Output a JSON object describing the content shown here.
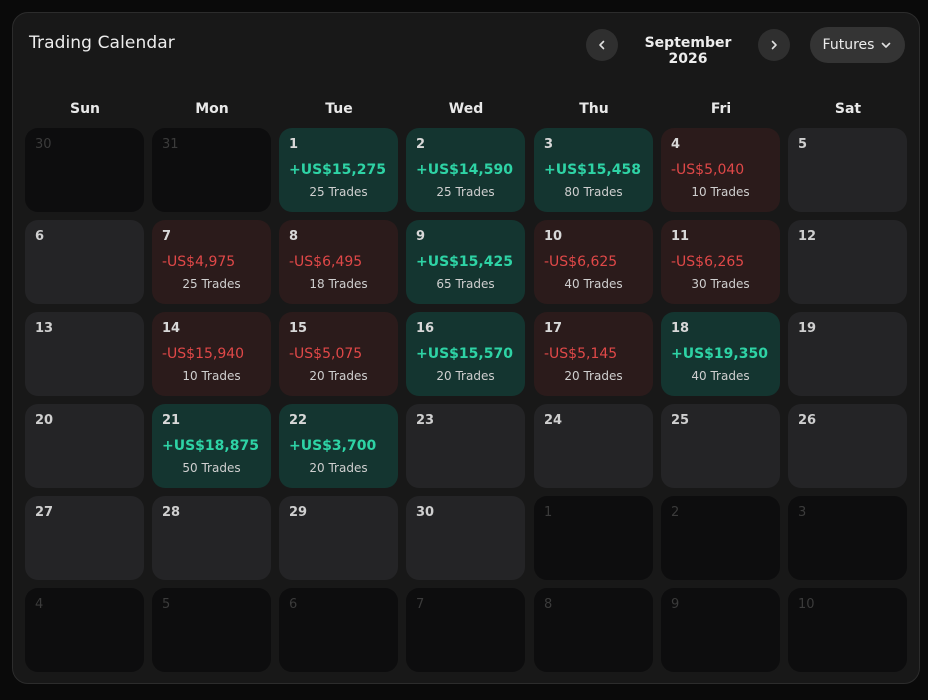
{
  "header": {
    "title": "Trading Calendar",
    "month_label": "September 2026",
    "dropdown_label": "Futures"
  },
  "weekdays": [
    "Sun",
    "Mon",
    "Tue",
    "Wed",
    "Thu",
    "Fri",
    "Sat"
  ],
  "weeks": [
    [
      {
        "day": "30",
        "state": "muted"
      },
      {
        "day": "31",
        "state": "muted"
      },
      {
        "day": "1",
        "state": "pos",
        "pnl": "+US$15,275",
        "trades": "25 Trades"
      },
      {
        "day": "2",
        "state": "pos",
        "pnl": "+US$14,590",
        "trades": "25 Trades"
      },
      {
        "day": "3",
        "state": "pos",
        "pnl": "+US$15,458",
        "trades": "80 Trades"
      },
      {
        "day": "4",
        "state": "neg",
        "pnl": "-US$5,040",
        "trades": "10 Trades"
      },
      {
        "day": "5",
        "state": "empty"
      }
    ],
    [
      {
        "day": "6",
        "state": "empty"
      },
      {
        "day": "7",
        "state": "neg",
        "pnl": "-US$4,975",
        "trades": "25 Trades"
      },
      {
        "day": "8",
        "state": "neg",
        "pnl": "-US$6,495",
        "trades": "18 Trades"
      },
      {
        "day": "9",
        "state": "pos",
        "pnl": "+US$15,425",
        "trades": "65 Trades"
      },
      {
        "day": "10",
        "state": "neg",
        "pnl": "-US$6,625",
        "trades": "40 Trades"
      },
      {
        "day": "11",
        "state": "neg",
        "pnl": "-US$6,265",
        "trades": "30 Trades"
      },
      {
        "day": "12",
        "state": "empty"
      }
    ],
    [
      {
        "day": "13",
        "state": "empty"
      },
      {
        "day": "14",
        "state": "neg",
        "pnl": "-US$15,940",
        "trades": "10 Trades"
      },
      {
        "day": "15",
        "state": "neg",
        "pnl": "-US$5,075",
        "trades": "20 Trades"
      },
      {
        "day": "16",
        "state": "pos",
        "pnl": "+US$15,570",
        "trades": "20 Trades"
      },
      {
        "day": "17",
        "state": "neg",
        "pnl": "-US$5,145",
        "trades": "20 Trades"
      },
      {
        "day": "18",
        "state": "pos",
        "pnl": "+US$19,350",
        "trades": "40 Trades"
      },
      {
        "day": "19",
        "state": "empty"
      }
    ],
    [
      {
        "day": "20",
        "state": "empty"
      },
      {
        "day": "21",
        "state": "pos",
        "pnl": "+US$18,875",
        "trades": "50 Trades"
      },
      {
        "day": "22",
        "state": "pos",
        "pnl": "+US$3,700",
        "trades": "20 Trades"
      },
      {
        "day": "23",
        "state": "empty"
      },
      {
        "day": "24",
        "state": "empty"
      },
      {
        "day": "25",
        "state": "empty"
      },
      {
        "day": "26",
        "state": "empty"
      }
    ],
    [
      {
        "day": "27",
        "state": "empty"
      },
      {
        "day": "28",
        "state": "empty"
      },
      {
        "day": "29",
        "state": "empty"
      },
      {
        "day": "30",
        "state": "empty"
      },
      {
        "day": "1",
        "state": "muted"
      },
      {
        "day": "2",
        "state": "muted"
      },
      {
        "day": "3",
        "state": "muted"
      }
    ],
    [
      {
        "day": "4",
        "state": "muted"
      },
      {
        "day": "5",
        "state": "muted"
      },
      {
        "day": "6",
        "state": "muted"
      },
      {
        "day": "7",
        "state": "muted"
      },
      {
        "day": "8",
        "state": "muted"
      },
      {
        "day": "9",
        "state": "muted"
      },
      {
        "day": "10",
        "state": "muted"
      }
    ]
  ],
  "colors": {
    "background": "#0a0a0a",
    "panel": "#181818",
    "positive": "#2ed3a5",
    "negative": "#e04848",
    "positive_cell": "#143530",
    "negative_cell": "#2b1b1b"
  },
  "icons": {
    "prev": "chevron-left-icon",
    "next": "chevron-right-icon",
    "dropdown": "chevron-down-icon"
  }
}
